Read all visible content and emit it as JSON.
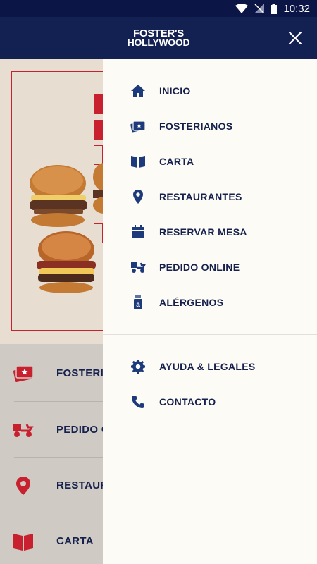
{
  "status_bar": {
    "time": "10:32"
  },
  "header": {
    "logo_line1": "FOSTER'S",
    "logo_line2": "HOLLYWOOD"
  },
  "drawer": {
    "primary_items": [
      {
        "label": "INICIO",
        "icon": "home-icon"
      },
      {
        "label": "FOSTERIANOS",
        "icon": "loyalty-card-icon"
      },
      {
        "label": "CARTA",
        "icon": "menu-book-icon"
      },
      {
        "label": "RESTAURANTES",
        "icon": "location-pin-icon"
      },
      {
        "label": "RESERVAR MESA",
        "icon": "calendar-icon"
      },
      {
        "label": "PEDIDO ONLINE",
        "icon": "delivery-scooter-icon"
      },
      {
        "label": "ALÉRGENOS",
        "icon": "allergens-icon"
      }
    ],
    "secondary_items": [
      {
        "label": "AYUDA & LEGALES",
        "icon": "gear-icon"
      },
      {
        "label": "CONTACTO",
        "icon": "phone-icon"
      }
    ]
  },
  "background_menu": {
    "items": [
      {
        "label": "FOSTERIANOS",
        "icon": "loyalty-card-icon"
      },
      {
        "label": "PEDIDO ONLINE",
        "icon": "delivery-scooter-icon"
      },
      {
        "label": "RESTAURANTES",
        "icon": "location-pin-icon"
      },
      {
        "label": "CARTA",
        "icon": "menu-book-icon"
      }
    ]
  },
  "colors": {
    "navy": "#122052",
    "red": "#c8202f",
    "drawer_bg": "#fdfbf6",
    "icon_blue": "#1d3a7a"
  }
}
